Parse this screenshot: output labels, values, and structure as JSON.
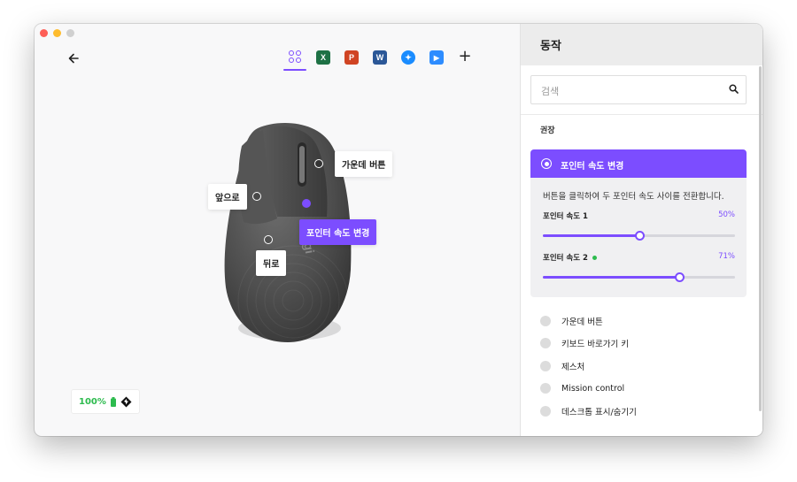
{
  "toolbar": {
    "back_icon": "arrow-left-icon",
    "app_tabs": [
      {
        "name": "all-apps",
        "icon": "grid-circles-icon",
        "active": true,
        "color": "#7c4dff"
      },
      {
        "name": "excel",
        "glyph": "X",
        "color": "#1e7145"
      },
      {
        "name": "powerpoint",
        "glyph": "P",
        "color": "#d04423"
      },
      {
        "name": "word",
        "glyph": "W",
        "color": "#2b5797"
      },
      {
        "name": "safari",
        "glyph": "✦",
        "color": "#1a8cff"
      },
      {
        "name": "zoom",
        "glyph": "▶",
        "color": "#2d8cff"
      }
    ],
    "add_label": "+"
  },
  "device": {
    "logo": "logi",
    "callouts": {
      "middle": "가운데 버튼",
      "forward": "앞으로",
      "back": "뒤로",
      "active": "포인터 속도 변경"
    },
    "battery": {
      "percent": "100%",
      "color": "#2dbb4e"
    }
  },
  "panel": {
    "title": "동작",
    "search_placeholder": "검색",
    "section_label": "권장",
    "selected": {
      "title": "포인터 속도 변경",
      "description": "버튼을 클릭하여 두 포인터 속도 사이를 전환합니다.",
      "sliders": [
        {
          "label": "포인터 속도 1",
          "value_text": "50%",
          "value": 0.5,
          "indicator": false
        },
        {
          "label": "포인터 속도 2",
          "value_text": "71%",
          "value": 0.71,
          "indicator": true
        }
      ]
    },
    "actions": [
      {
        "label": "가운데 버튼"
      },
      {
        "label": "키보드 바로가기 키"
      },
      {
        "label": "제스처"
      },
      {
        "label": "Mission control"
      },
      {
        "label": "데스크톱 표시/숨기기"
      }
    ],
    "accent": "#7c4dff"
  }
}
